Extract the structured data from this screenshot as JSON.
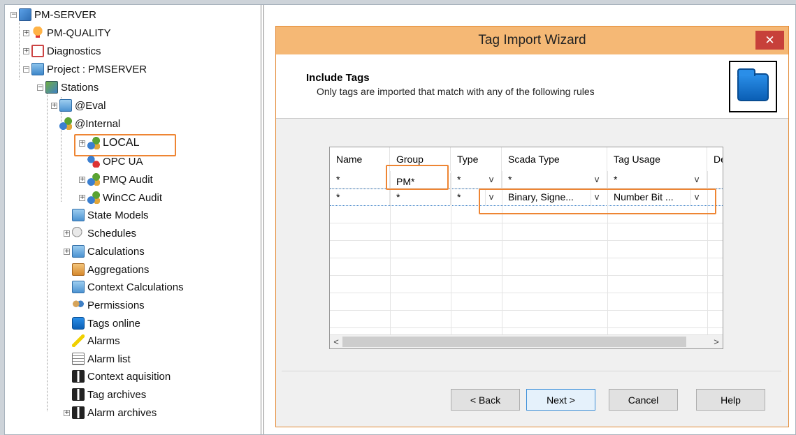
{
  "tree": {
    "items": [
      {
        "label": "PM-SERVER",
        "icon": "server-icon"
      },
      {
        "label": "PM-QUALITY",
        "icon": "quality-award-icon"
      },
      {
        "label": "Diagnostics",
        "icon": "diagnostics-icon"
      },
      {
        "label": "Project : PMSERVER",
        "icon": "project-icon"
      },
      {
        "label": "Stations",
        "icon": "stations-icon"
      },
      {
        "label": "@Eval",
        "icon": "eval-station-icon"
      },
      {
        "label": "@Internal",
        "icon": "network-station-icon"
      },
      {
        "label": "LOCAL",
        "icon": "network-station-icon"
      },
      {
        "label": "OPC UA",
        "icon": "opc-ua-icon"
      },
      {
        "label": "PMQ Audit",
        "icon": "network-station-icon"
      },
      {
        "label": "WinCC Audit",
        "icon": "network-station-icon"
      },
      {
        "label": "State Models",
        "icon": "state-models-icon"
      },
      {
        "label": "Schedules",
        "icon": "schedules-icon"
      },
      {
        "label": "Calculations",
        "icon": "calculations-icon"
      },
      {
        "label": "Aggregations",
        "icon": "aggregations-icon"
      },
      {
        "label": "Context Calculations",
        "icon": "context-calculations-icon"
      },
      {
        "label": "Permissions",
        "icon": "permissions-icon"
      },
      {
        "label": "Tags online",
        "icon": "tags-online-icon"
      },
      {
        "label": "Alarms",
        "icon": "alarms-icon"
      },
      {
        "label": "Alarm list",
        "icon": "alarm-list-icon"
      },
      {
        "label": "Context aquisition",
        "icon": "context-acquisition-icon"
      },
      {
        "label": "Tag archives",
        "icon": "tag-archives-icon"
      },
      {
        "label": "Alarm archives",
        "icon": "alarm-archives-icon"
      }
    ]
  },
  "dialog": {
    "title": "Tag Import Wizard",
    "close_glyph": "✕",
    "header_title": "Include Tags",
    "header_subtitle": "Only tags are imported that match with any of the following rules",
    "grid": {
      "columns": [
        "Name",
        "Group",
        "Type",
        "Scada Type",
        "Tag Usage",
        "Description"
      ],
      "rows": [
        {
          "name": "*",
          "group": "PM*",
          "type": "*",
          "scada_type": "*",
          "tag_usage": "*"
        },
        {
          "name": "*",
          "group": "*",
          "type": "*",
          "scada_type": "Binary, Signe...",
          "tag_usage": "Number Bit ..."
        }
      ],
      "dropdown_glyph": "v",
      "scroll_left": "<",
      "scroll_right": ">"
    },
    "buttons": {
      "back": "< Back",
      "next": "Next >",
      "cancel": "Cancel",
      "help": "Help"
    }
  },
  "colors": {
    "highlight": "#ee8533",
    "titlebar": "#f5b875",
    "close": "#c7403a"
  }
}
